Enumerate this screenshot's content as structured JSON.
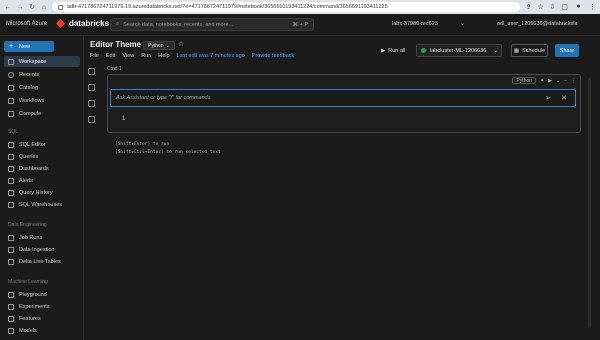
{
  "browser": {
    "url": "adb-471786724711979.19.azuredatabricks.net/?o=471786724711979#notebook/3656691193411224/command/3656691193411225"
  },
  "topbar": {
    "brand": "Microsoft Azure",
    "logo": "databricks",
    "search_placeholder": "Search data, notebooks, recents, and more...",
    "search_shortcut": "⌘ + P",
    "workspace": "labs-37980-rec623",
    "user": "odl_user_1206636@databricksla"
  },
  "sidebar": {
    "new_label": "New",
    "items_main": [
      {
        "label": "Workspace",
        "icon": "folder-icon"
      },
      {
        "label": "Recents",
        "icon": "clock-icon"
      },
      {
        "label": "Catalog",
        "icon": "catalog-icon"
      },
      {
        "label": "Workflows",
        "icon": "workflows-icon"
      },
      {
        "label": "Compute",
        "icon": "cloud-icon"
      }
    ],
    "section_sql": "SQL",
    "items_sql": [
      {
        "label": "SQL Editor"
      },
      {
        "label": "Queries"
      },
      {
        "label": "Dashboards"
      },
      {
        "label": "Alerts"
      },
      {
        "label": "Query History"
      },
      {
        "label": "SQL Warehouses"
      }
    ],
    "section_de": "Data Engineering",
    "items_de": [
      {
        "label": "Job Runs"
      },
      {
        "label": "Data Ingestion"
      },
      {
        "label": "Delta Live Tables"
      }
    ],
    "section_ml": "Machine Learning",
    "items_ml": [
      {
        "label": "Playground"
      },
      {
        "label": "Experiments"
      },
      {
        "label": "Features"
      },
      {
        "label": "Models"
      }
    ]
  },
  "notebook": {
    "title": "Editor Theme",
    "language": "Python",
    "menu": [
      "File",
      "Edit",
      "View",
      "Run",
      "Help"
    ],
    "last_edit": "Last edit was 7 minutes ago",
    "feedback": "Provide feedback",
    "run_all": "Run all",
    "cluster": "labcluster-ML-1206636",
    "schedule": "Schedule",
    "share": "Share"
  },
  "cell": {
    "label": "Cmd 1",
    "language": "Python",
    "assistant_placeholder": "Ask Assistant or type \"/\" for commands",
    "line_number": "1",
    "hint1": "[Shift+Enter] to run",
    "hint2": "[Shift+Ctrl+Enter] to run selected text"
  },
  "colors": {
    "accent": "#2272b4",
    "background": "#1b1b1b",
    "cluster_status": "#24a148"
  }
}
